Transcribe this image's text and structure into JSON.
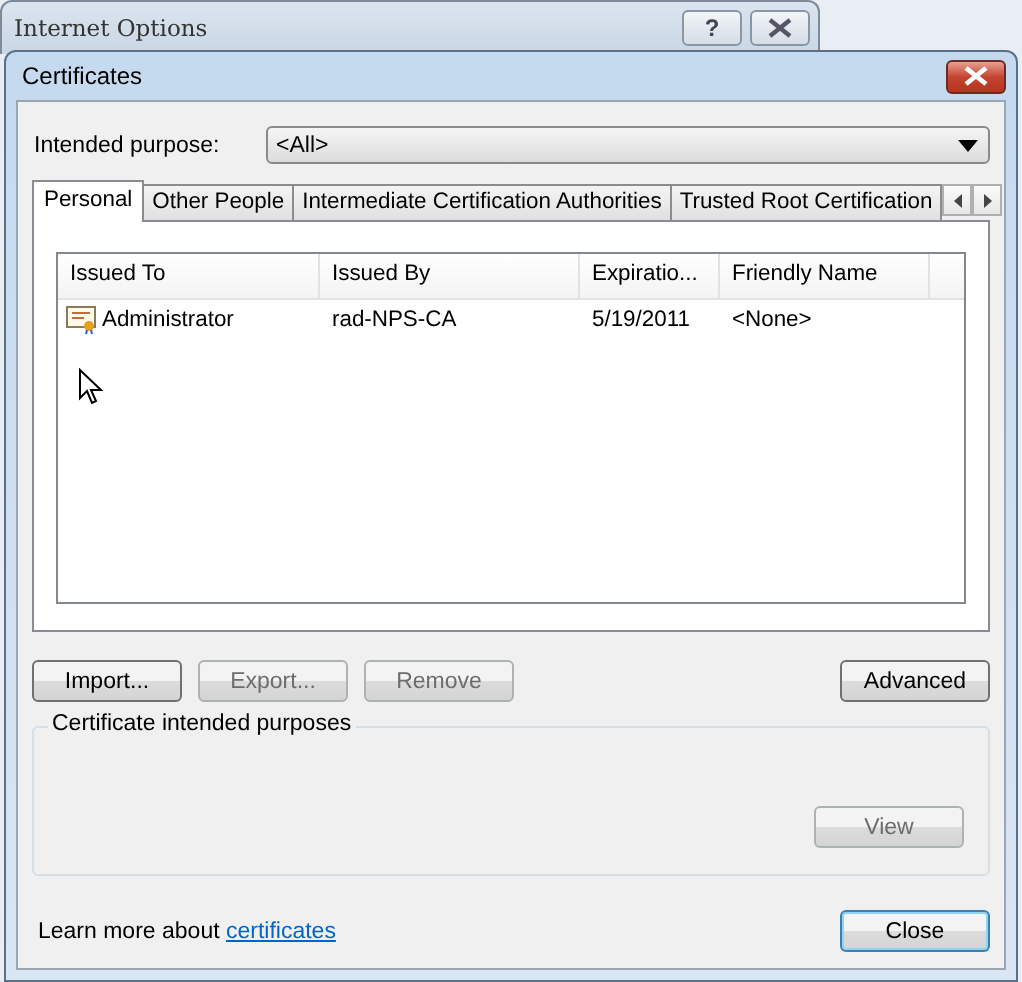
{
  "background_window": {
    "title": "Internet Options",
    "help_button": "?"
  },
  "dialog": {
    "title": "Certificates"
  },
  "intended_purpose": {
    "label": "Intended purpose:",
    "value": "<All>"
  },
  "tabs": [
    {
      "label": "Personal",
      "selected": true
    },
    {
      "label": "Other People",
      "selected": false
    },
    {
      "label": "Intermediate Certification Authorities",
      "selected": false
    },
    {
      "label": "Trusted Root Certification",
      "selected": false
    }
  ],
  "table": {
    "columns": [
      "Issued To",
      "Issued By",
      "Expiratio...",
      "Friendly Name"
    ],
    "rows": [
      {
        "cells": [
          "Administrator",
          "rad-NPS-CA",
          "5/19/2011",
          "<None>"
        ],
        "selected": false
      }
    ]
  },
  "buttons": [
    {
      "label": "Import...",
      "disabled": false
    },
    {
      "label": "Export...",
      "disabled": true
    },
    {
      "label": "Remove",
      "disabled": true
    }
  ],
  "advanced_button": {
    "label": "Advanced",
    "disabled": false
  },
  "purposes_group": {
    "title": "Certificate intended purposes",
    "view_button": {
      "label": "View",
      "disabled": true
    }
  },
  "footer": {
    "text": "Learn more about ",
    "link": "certificates",
    "close_button": "Close"
  }
}
